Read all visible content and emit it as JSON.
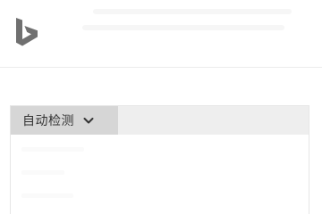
{
  "header": {
    "logo_icon": "bing-logo-icon",
    "logo_color": "#707070"
  },
  "translator": {
    "source_language": {
      "selected": "自动检测",
      "icon": "chevron-down-icon"
    },
    "source_text": {
      "value": ""
    }
  }
}
